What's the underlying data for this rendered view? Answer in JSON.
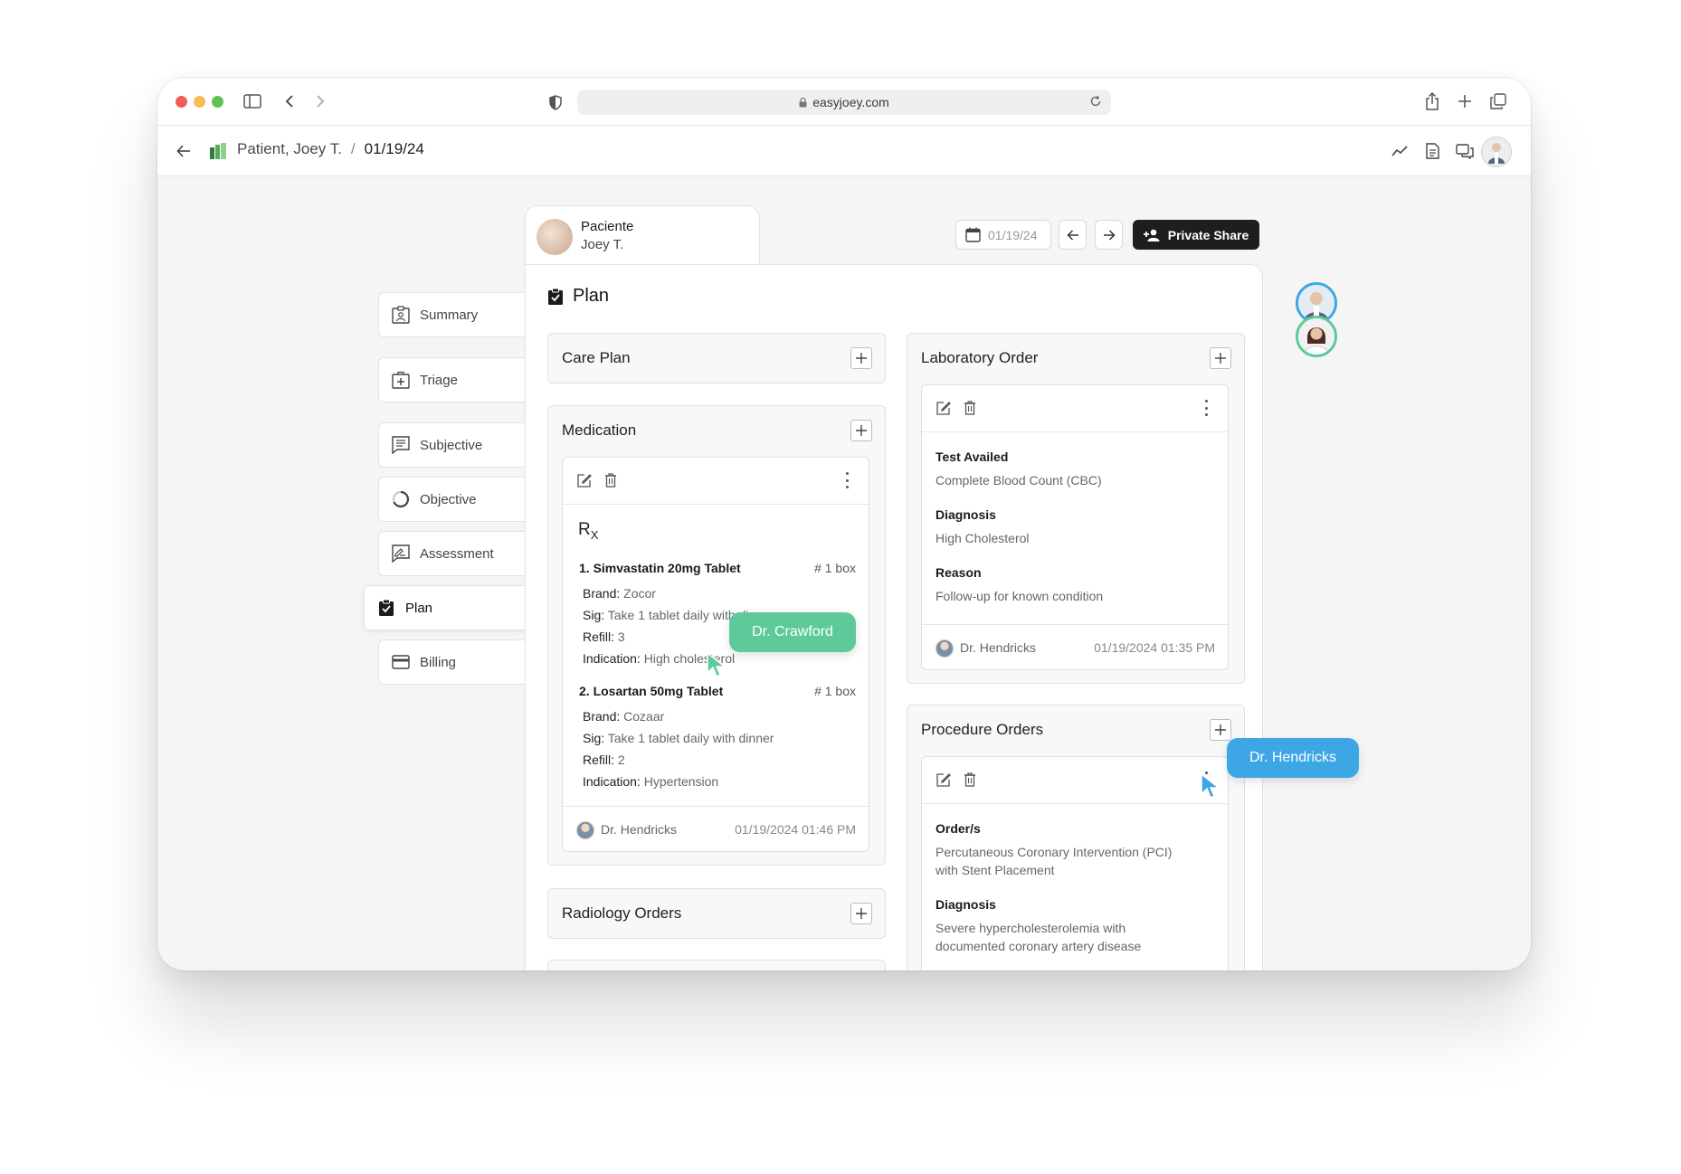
{
  "browser": {
    "url": "easyjoey.com"
  },
  "appbar": {
    "breadcrumb_patient": "Patient, Joey T.",
    "breadcrumb_sep": "/",
    "breadcrumb_date": "01/19/24"
  },
  "sidenav": {
    "items": [
      {
        "label": "Summary",
        "icon": "clipboard-user-icon"
      },
      {
        "label": "Triage",
        "icon": "medical-kit-icon"
      },
      {
        "label": "Subjective",
        "icon": "text-list-icon"
      },
      {
        "label": "Objective",
        "icon": "circle-progress-icon"
      },
      {
        "label": "Assessment",
        "icon": "signature-icon"
      },
      {
        "label": "Plan",
        "icon": "clipboard-check-icon",
        "active": true
      },
      {
        "label": "Billing",
        "icon": "credit-card-icon"
      }
    ]
  },
  "patient_tab": {
    "line1": "Paciente",
    "line2": "Joey T."
  },
  "toolbar": {
    "date": "01/19/24",
    "share_label": "Private Share"
  },
  "plan": {
    "title": "Plan"
  },
  "care_plan": {
    "title": "Care Plan"
  },
  "medication": {
    "title": "Medication",
    "rx": "R",
    "rx_sub": "X",
    "meds": [
      {
        "name": "1. Simvastatin 20mg Tablet",
        "qty": "# 1 box",
        "brand_label": "Brand:",
        "brand": "Zocor",
        "sig_label": "Sig:",
        "sig": "Take 1 tablet daily with dinner",
        "refill_label": "Refill:",
        "refill": "3",
        "indication_label": "Indication:",
        "indication": "High cholesterol"
      },
      {
        "name": "2. Losartan 50mg Tablet",
        "qty": "# 1 box",
        "brand_label": "Brand:",
        "brand": "Cozaar",
        "sig_label": "Sig:",
        "sig": "Take 1 tablet daily with dinner",
        "refill_label": "Refill:",
        "refill": "2",
        "indication_label": "Indication:",
        "indication": "Hypertension"
      }
    ],
    "author": "Dr. Hendricks",
    "timestamp": "01/19/2024 01:46 PM"
  },
  "radiology": {
    "title": "Radiology Orders"
  },
  "lab_order": {
    "title": "Laboratory Order",
    "test_label": "Test Availed",
    "test": "Complete Blood Count (CBC)",
    "diagnosis_label": "Diagnosis",
    "diagnosis": "High Cholesterol",
    "reason_label": "Reason",
    "reason": "Follow-up for known condition",
    "author": "Dr. Hendricks",
    "timestamp": "01/19/2024 01:35 PM"
  },
  "procedure": {
    "title": "Procedure Orders",
    "orders_label": "Order/s",
    "orders_line1": "Percutaneous Coronary Intervention (PCI)",
    "orders_line2": "with Stent Placement",
    "diagnosis_label": "Diagnosis",
    "diagnosis_line1": "Severe hypercholesterolemia with",
    "diagnosis_line2": "documented coronary artery disease"
  },
  "cursors": [
    {
      "name": "Dr. Crawford",
      "color": "#5ec99a"
    },
    {
      "name": "Dr. Hendricks",
      "color": "#3da7e6"
    }
  ],
  "colors": {
    "traffic_red": "#ee5f57",
    "traffic_yellow": "#f5bd4f",
    "traffic_green": "#5fc454",
    "dark_button": "#1e1e1e"
  }
}
